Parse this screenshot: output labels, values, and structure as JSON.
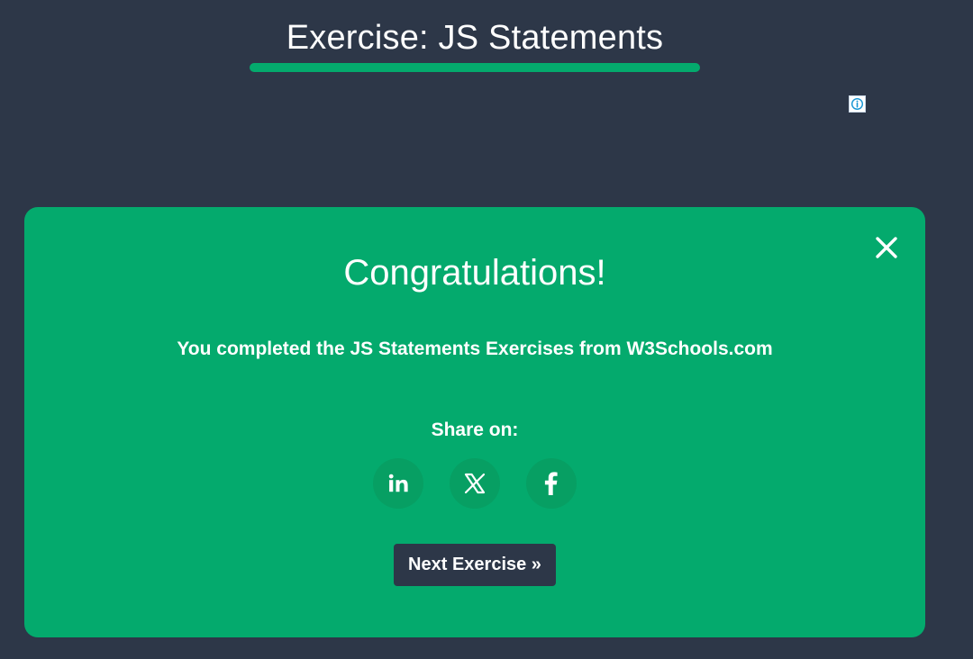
{
  "page": {
    "title": "Exercise: JS Statements"
  },
  "ad": {
    "icon": "info-icon"
  },
  "modal": {
    "heading": "Congratulations!",
    "completion_message": "You completed the JS Statements Exercises from W3Schools.com",
    "share_label": "Share on:",
    "next_button_label": "Next Exercise »",
    "close_icon": "close-icon",
    "share_buttons": [
      {
        "name": "linkedin-share-button",
        "icon": "linkedin-icon"
      },
      {
        "name": "x-share-button",
        "icon": "x-icon"
      },
      {
        "name": "facebook-share-button",
        "icon": "facebook-icon"
      }
    ]
  },
  "colors": {
    "background": "#2d3748",
    "accent": "#04aa6d",
    "button_dark": "#2d3748",
    "share_circle": "#079f63",
    "text": "#ffffff"
  }
}
